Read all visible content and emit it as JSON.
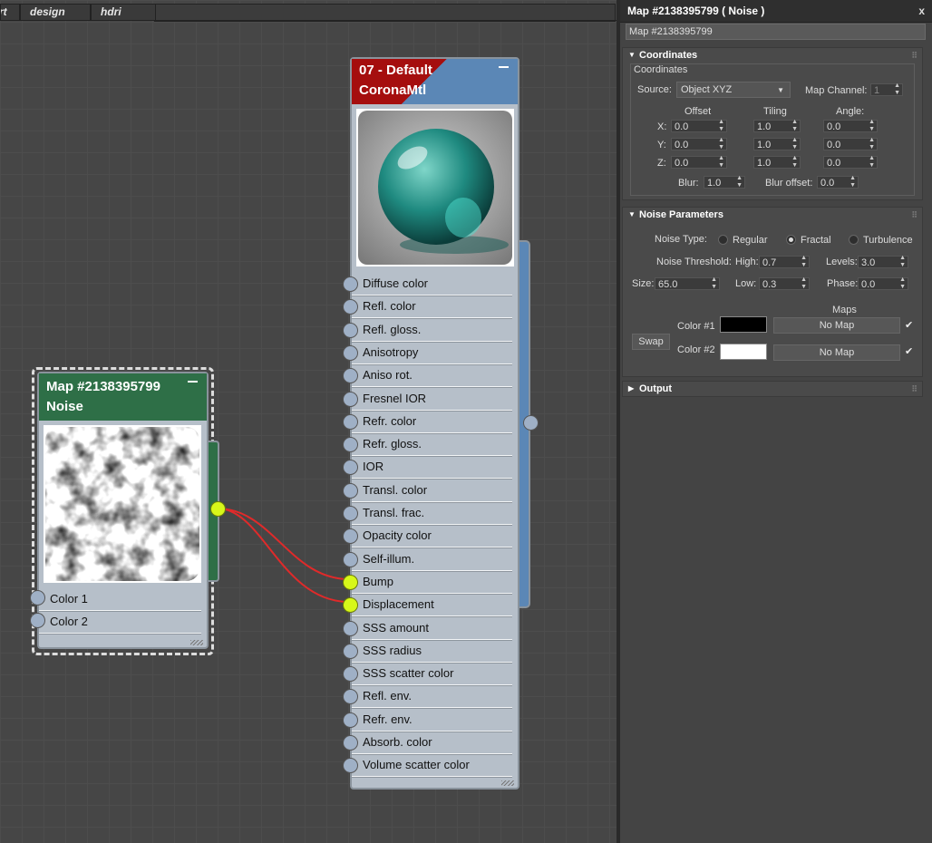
{
  "tabs": [
    "rt",
    "design",
    "hdri"
  ],
  "mtl_node": {
    "title_line1": "07 - Default",
    "title_line2": "CoronaMtl",
    "header_color_left": "#a50e0e",
    "header_color_right": "#5b87b6",
    "slots": [
      "Diffuse color",
      "Refl. color",
      "Refl. gloss.",
      "Anisotropy",
      "Aniso rot.",
      "Fresnel IOR",
      "Refr. color",
      "Refr. gloss.",
      "IOR",
      "Transl. color",
      "Transl. frac.",
      "Opacity color",
      "Self-illum.",
      "Bump",
      "Displacement",
      "SSS amount",
      "SSS radius",
      "SSS scatter color",
      "Refl. env.",
      "Refr. env.",
      "Absorb. color",
      "Volume scatter color"
    ],
    "connected_slots": [
      "Bump",
      "Displacement"
    ]
  },
  "noise_node": {
    "title_line1": "Map #2138395799",
    "title_line2": "Noise",
    "header_color": "#2e6f47",
    "slots": [
      "Color 1",
      "Color 2"
    ]
  },
  "wire_color": "#e02a2a",
  "panel": {
    "title": "Map #2138395799  ( Noise )",
    "close_label": "x",
    "name_value": "Map #2138395799",
    "coordinates": {
      "rollout_title": "Coordinates",
      "group_label": "Coordinates",
      "source_label": "Source:",
      "source_value": "Object XYZ",
      "map_channel_label": "Map Channel:",
      "map_channel_value": "1",
      "offset_label": "Offset",
      "tiling_label": "Tiling",
      "angle_label": "Angle:",
      "rows": [
        {
          "axis": "X:",
          "offset": "0.0",
          "tiling": "1.0",
          "angle": "0.0"
        },
        {
          "axis": "Y:",
          "offset": "0.0",
          "tiling": "1.0",
          "angle": "0.0"
        },
        {
          "axis": "Z:",
          "offset": "0.0",
          "tiling": "1.0",
          "angle": "0.0"
        }
      ],
      "blur_label": "Blur:",
      "blur_value": "1.0",
      "blur_offset_label": "Blur offset:",
      "blur_offset_value": "0.0"
    },
    "noise": {
      "rollout_title": "Noise Parameters",
      "type_label": "Noise Type:",
      "types": [
        "Regular",
        "Fractal",
        "Turbulence"
      ],
      "selected_type": "Fractal",
      "threshold_label": "Noise Threshold:",
      "high_label": "High:",
      "high_value": "0.7",
      "levels_label": "Levels:",
      "levels_value": "3.0",
      "size_label": "Size:",
      "size_value": "65.0",
      "low_label": "Low:",
      "low_value": "0.3",
      "phase_label": "Phase:",
      "phase_value": "0.0",
      "maps_label": "Maps",
      "swap_label": "Swap",
      "color1_label": "Color #1",
      "color1_value": "#000000",
      "color1_map": "No Map",
      "color2_label": "Color #2",
      "color2_value": "#ffffff",
      "color2_map": "No Map"
    },
    "output": {
      "rollout_title": "Output"
    }
  }
}
